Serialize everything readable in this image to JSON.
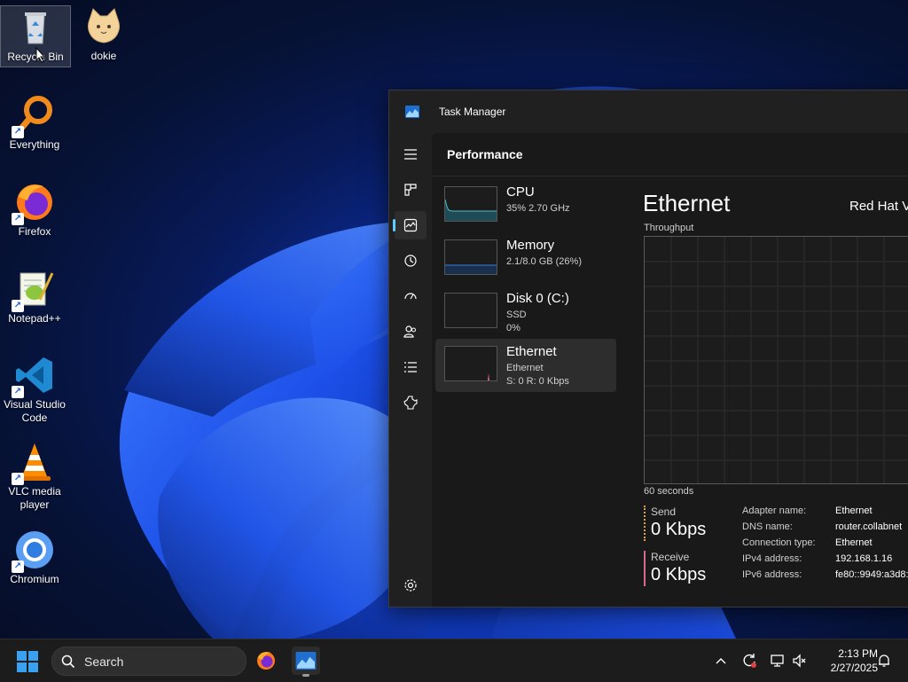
{
  "desktop": {
    "icons": [
      {
        "label": "Recycle Bin",
        "icon": "recycle-bin-icon",
        "shortcut": false
      },
      {
        "label": "dokie",
        "icon": "cat-icon",
        "shortcut": false
      },
      {
        "label": "Everything",
        "icon": "magnifier-icon",
        "shortcut": true
      },
      {
        "label": "Firefox",
        "icon": "firefox-icon",
        "shortcut": true
      },
      {
        "label": "Notepad++",
        "icon": "notepadpp-icon",
        "shortcut": true
      },
      {
        "label": "Visual Studio Code",
        "icon": "vscode-icon",
        "shortcut": true
      },
      {
        "label": "VLC media player",
        "icon": "vlc-icon",
        "shortcut": true
      },
      {
        "label": "Chromium",
        "icon": "chromium-icon",
        "shortcut": true
      }
    ]
  },
  "task_manager": {
    "title": "Task Manager",
    "page_title": "Performance",
    "nav": [
      "menu-icon",
      "processes-icon",
      "performance-icon",
      "app-history-icon",
      "startup-apps-icon",
      "users-icon",
      "details-icon",
      "services-icon",
      "settings-icon"
    ],
    "perf_items": [
      {
        "name": "CPU",
        "sub1": "35% 2.70 GHz",
        "sub2": ""
      },
      {
        "name": "Memory",
        "sub1": "2.1/8.0 GB (26%)",
        "sub2": ""
      },
      {
        "name": "Disk 0 (C:)",
        "sub1": "SSD",
        "sub2": "0%"
      },
      {
        "name": "Ethernet",
        "sub1": "Ethernet",
        "sub2": "S: 0 R: 0 Kbps"
      }
    ],
    "detail": {
      "title": "Ethernet",
      "adapter_model": "Red Hat V",
      "graph_label": "Throughput",
      "time_label": "60 seconds",
      "send_label": "Send",
      "send_value": "0 Kbps",
      "receive_label": "Receive",
      "receive_value": "0 Kbps",
      "properties": [
        {
          "k": "Adapter name:",
          "v": "Ethernet"
        },
        {
          "k": "DNS name:",
          "v": "router.collabnet"
        },
        {
          "k": "Connection type:",
          "v": "Ethernet"
        },
        {
          "k": "IPv4 address:",
          "v": "192.168.1.16"
        },
        {
          "k": "IPv6 address:",
          "v": "fe80::9949:a3d8:"
        }
      ]
    },
    "colors": {
      "accent": "#60cdff",
      "cpu": "#4cc2c4",
      "memory": "#3a7fd5",
      "ethernet": "#d86a8e",
      "send": "#d6a24a",
      "receive": "#d86a8e"
    }
  },
  "taskbar": {
    "search_placeholder": "Search",
    "time": "2:13 PM",
    "date": "2/27/2025"
  }
}
